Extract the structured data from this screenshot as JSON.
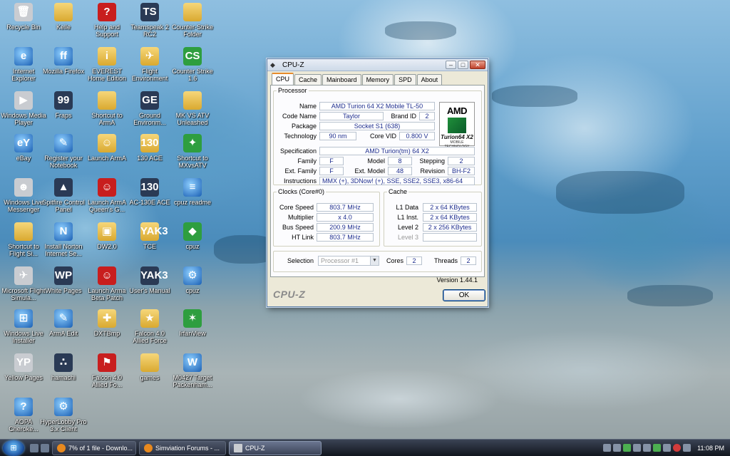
{
  "desktop": {
    "icons": [
      {
        "label": "Recycle Bin",
        "glyph": "🗑"
      },
      {
        "label": "Kelle",
        "glyph": ""
      },
      {
        "label": "Help and Support",
        "glyph": "?"
      },
      {
        "label": "Teamspeak 2 RC2",
        "glyph": "TS"
      },
      {
        "label": "Counter-Strike Folder",
        "glyph": ""
      },
      {
        "label": "Internet Explorer",
        "glyph": "e"
      },
      {
        "label": "Mozilla Firefox",
        "glyph": "ff"
      },
      {
        "label": "EVEREST Home Edition",
        "glyph": "i"
      },
      {
        "label": "Flight Environment",
        "glyph": "✈"
      },
      {
        "label": "Counter Strike 1.6",
        "glyph": "CS"
      },
      {
        "label": "Windows Media Player",
        "glyph": "▶"
      },
      {
        "label": "Fraps",
        "glyph": "99"
      },
      {
        "label": "Shortcut to ArmA",
        "glyph": ""
      },
      {
        "label": "Ground Environm...",
        "glyph": "GE"
      },
      {
        "label": "MK VS ATV Unleashed",
        "glyph": ""
      },
      {
        "label": "eBay",
        "glyph": "eY"
      },
      {
        "label": "Register your Notebook",
        "glyph": "✎"
      },
      {
        "label": "Launch ArmA",
        "glyph": "☺"
      },
      {
        "label": "130 ACE",
        "glyph": "130"
      },
      {
        "label": "Shortcut to MXvsATV",
        "glyph": "✦"
      },
      {
        "label": "Windows Live Messenger",
        "glyph": "☻"
      },
      {
        "label": "Spitfire Control Panel",
        "glyph": "▲"
      },
      {
        "label": "Launch ArmA Queen's G...",
        "glyph": "☺"
      },
      {
        "label": "AC-130E ACE",
        "glyph": "130"
      },
      {
        "label": "cpuz readme",
        "glyph": "≡"
      },
      {
        "label": "Shortcut to Flight Si...",
        "glyph": ""
      },
      {
        "label": "Install Norton Internet Se...",
        "glyph": "N"
      },
      {
        "label": "DW2.0",
        "glyph": "▣"
      },
      {
        "label": "TCE",
        "glyph": "YAK3"
      },
      {
        "label": "cpuz",
        "glyph": "◆"
      },
      {
        "label": "Microsoft Flight Simula...",
        "glyph": "✈"
      },
      {
        "label": "White Pages",
        "glyph": "WP"
      },
      {
        "label": "Launch Arma Beta Patch",
        "glyph": "☺"
      },
      {
        "label": "User's Manual",
        "glyph": "YAK3"
      },
      {
        "label": "cpuz",
        "glyph": "⚙"
      },
      {
        "label": "Windows Live Installer",
        "glyph": "⊞"
      },
      {
        "label": "ArmA Edit",
        "glyph": "✎"
      },
      {
        "label": "DXTBmp",
        "glyph": "✚"
      },
      {
        "label": "Falcon 4.0 Allied Force",
        "glyph": "★"
      },
      {
        "label": "IrfanView",
        "glyph": "✶"
      },
      {
        "label": "Yellow Pages",
        "glyph": "YP"
      },
      {
        "label": "hamachi",
        "glyph": "∴"
      },
      {
        "label": "Falcon 4.0 Allied Fo...",
        "glyph": "⚑"
      },
      {
        "label": "games",
        "glyph": ""
      },
      {
        "label": "M0427 Target Packenham...",
        "glyph": "W"
      },
      {
        "label": "AOPA Cheroke...",
        "glyph": "?"
      },
      {
        "label": "HyperLobby Pro 3.x Client",
        "glyph": "⚙"
      }
    ]
  },
  "window": {
    "title": "CPU-Z",
    "controls": {
      "minimize": "–",
      "maximize": "□",
      "close": "✕"
    },
    "tabs": [
      "CPU",
      "Cache",
      "Mainboard",
      "Memory",
      "SPD",
      "About"
    ],
    "active_tab": "CPU",
    "processor": {
      "legend": "Processor",
      "name_label": "Name",
      "name": "AMD Turion 64 X2 Mobile TL-50",
      "codename_label": "Code Name",
      "codename": "Taylor",
      "brandid_label": "Brand ID",
      "brandid": "2",
      "package_label": "Package",
      "package": "Socket S1 (638)",
      "technology_label": "Technology",
      "technology": "90 nm",
      "corevid_label": "Core VID",
      "corevid": "0.800 V",
      "spec_label": "Specification",
      "spec": "AMD Turion(tm) 64 X2",
      "family_label": "Family",
      "family": "F",
      "model_label": "Model",
      "model": "8",
      "stepping_label": "Stepping",
      "stepping": "2",
      "extfamily_label": "Ext. Family",
      "extfamily": "F",
      "extmodel_label": "Ext. Model",
      "extmodel": "48",
      "revision_label": "Revision",
      "revision": "BH-F2",
      "instructions_label": "Instructions",
      "instructions": "MMX (+), 3DNow! (+), SSE, SSE2, SSE3, x86-64"
    },
    "logo": {
      "brand": "AMD",
      "product": "Turion64 X2",
      "sub": "MOBILE TECHNOLOGY"
    },
    "clocks": {
      "legend": "Clocks (Core#0)",
      "corespeed_label": "Core Speed",
      "corespeed": "803.7 MHz",
      "multiplier_label": "Multiplier",
      "multiplier": "x 4.0",
      "busspeed_label": "Bus Speed",
      "busspeed": "200.9 MHz",
      "htlink_label": "HT Link",
      "htlink": "803.7 MHz"
    },
    "cache": {
      "legend": "Cache",
      "l1data_label": "L1 Data",
      "l1data": "2 x 64 KBytes",
      "l1inst_label": "L1 Inst.",
      "l1inst": "2 x 64 KBytes",
      "level2_label": "Level 2",
      "level2": "2 x 256 KBytes",
      "level3_label": "Level 3",
      "level3": ""
    },
    "selection": {
      "label": "Selection",
      "value": "Processor #1",
      "cores_label": "Cores",
      "cores": "2",
      "threads_label": "Threads",
      "threads": "2"
    },
    "version": "Version 1.44.1",
    "brand_text": "CPU-Z",
    "ok_label": "OK"
  },
  "taskbar": {
    "start_glyph": "⊞",
    "buttons": [
      {
        "label": "7% of 1 file - Downlo..."
      },
      {
        "label": "Simviation Forums - ..."
      },
      {
        "label": "CPU-Z"
      }
    ],
    "clock": "11:08 PM"
  },
  "colors": {
    "value_text": "#1f2f8f",
    "window_bg": "#ece9d8",
    "tab_accent": "#e68b2c"
  }
}
